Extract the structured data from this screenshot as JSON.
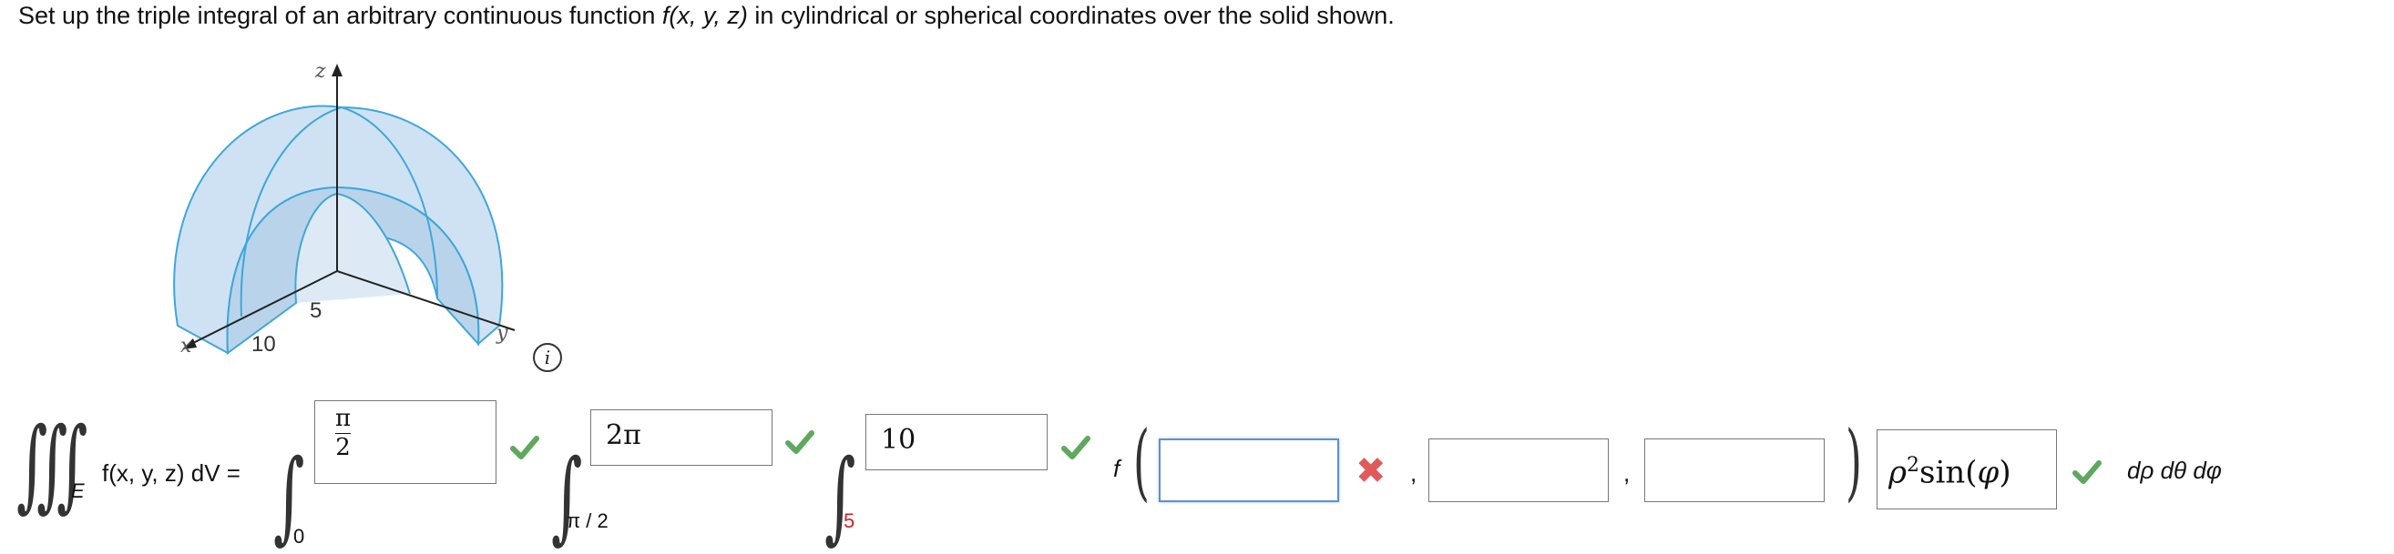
{
  "prompt": {
    "before": "Set up the triple integral of an arbitrary continuous function ",
    "func": "f(x, y, z)",
    "after": " in cylindrical or spherical coordinates over the solid shown."
  },
  "figure": {
    "axis_x": "x",
    "axis_y": "y",
    "axis_z": "z",
    "tick_outer": "10",
    "tick_inner": "5"
  },
  "integral": {
    "lhs_subscript": "E",
    "lhs": "f(x, y, z) dV =",
    "bounds": [
      {
        "lower": "0",
        "upper_num": "π",
        "upper_den": "2",
        "status": "correct"
      },
      {
        "lower": "π / 2",
        "upper": "2π",
        "status": "correct"
      },
      {
        "lower": "5",
        "upper": "10",
        "status": "correct",
        "lower_color": "#cc2222"
      }
    ],
    "f_label": "f",
    "args": [
      {
        "value": "",
        "status": "incorrect"
      },
      {
        "value": "",
        "status": ""
      },
      {
        "value": "",
        "status": ""
      }
    ],
    "commas": [
      ",",
      ","
    ],
    "jacobian": {
      "rho": "ρ",
      "exp": "2",
      "sin": "sin",
      "phi": "φ",
      "status": "correct"
    },
    "differentials": "dρ dθ dφ"
  },
  "colors": {
    "check": "#5fa85f",
    "cross": "#e05a5a",
    "shell_fill": "#cfe2f3",
    "shell_stroke": "#3fa6d9",
    "focus_border": "#5b8fd6"
  }
}
